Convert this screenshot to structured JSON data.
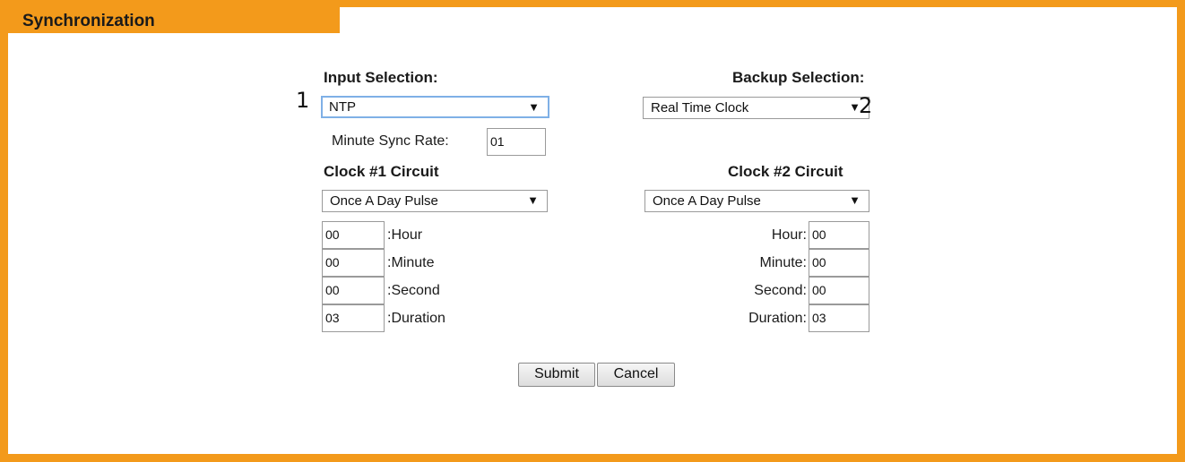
{
  "panel": {
    "title": "Synchronization"
  },
  "input": {
    "heading": "Input Selection:",
    "selected": "NTP",
    "sync_rate_label": "Minute Sync Rate:",
    "sync_rate_value": "01"
  },
  "backup": {
    "heading": "Backup Selection:",
    "selected": "Real Time Clock"
  },
  "clock1": {
    "heading": "Clock #1 Circuit",
    "mode": "Once A Day Pulse",
    "fields": [
      {
        "value": "00",
        "label": ":Hour"
      },
      {
        "value": "00",
        "label": ":Minute"
      },
      {
        "value": "00",
        "label": ":Second"
      },
      {
        "value": "03",
        "label": ":Duration"
      }
    ]
  },
  "clock2": {
    "heading": "Clock #2 Circuit",
    "mode": "Once A Day Pulse",
    "fields": [
      {
        "value": "00",
        "label": "Hour:"
      },
      {
        "value": "00",
        "label": "Minute:"
      },
      {
        "value": "00",
        "label": "Second:"
      },
      {
        "value": "03",
        "label": "Duration:"
      }
    ]
  },
  "buttons": {
    "submit": "Submit",
    "cancel": "Cancel"
  },
  "annotations": {
    "marker1": "1",
    "marker2": "2"
  },
  "icons": {
    "dropdown": "chevron-down-icon"
  },
  "colors": {
    "accent": "#f39a1b",
    "focus": "#7fb0e6"
  }
}
